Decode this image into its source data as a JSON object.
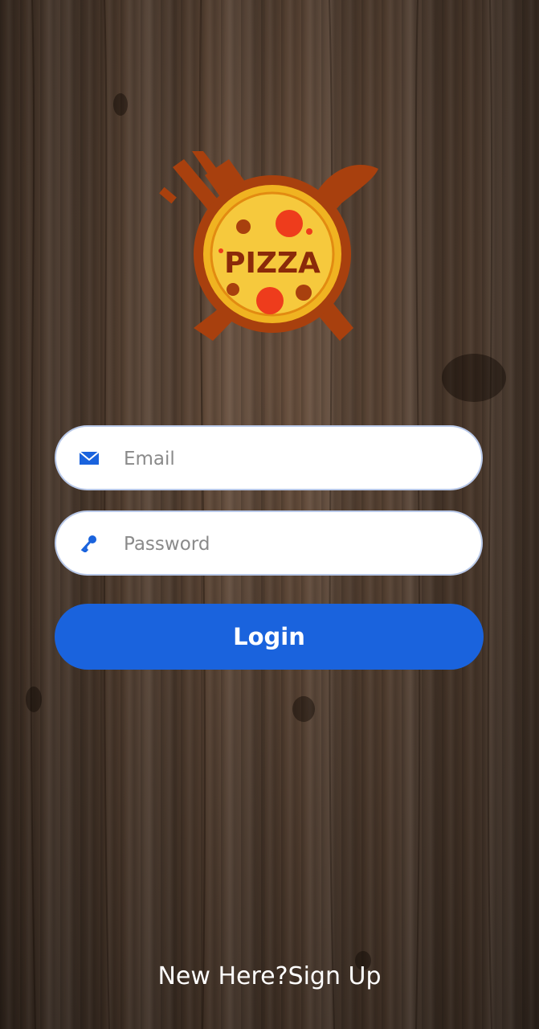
{
  "logo": {
    "text": "PIZZA"
  },
  "form": {
    "email": {
      "placeholder": "Email",
      "value": "",
      "icon": "envelope-icon"
    },
    "password": {
      "placeholder": "Password",
      "value": "",
      "icon": "key-icon"
    },
    "login_label": "Login"
  },
  "footer": {
    "prompt": "New Here?",
    "link": "Sign Up"
  },
  "colors": {
    "accent": "#1a63dd",
    "field_border": "#b8c8e8",
    "text_light": "#ffffff"
  }
}
